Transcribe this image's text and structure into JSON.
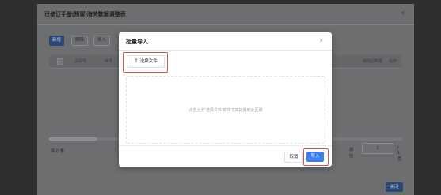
{
  "background": {
    "title": "已修订手册(预留)海关数据调整表",
    "close_symbol": "×",
    "toolbar": [
      "新增",
      "删除",
      "导入"
    ],
    "table_headers": [
      "关联号",
      "序号",
      "修改后数量",
      "操作"
    ],
    "total_text": "共 0 条",
    "pager": {
      "goto_label": "前往",
      "page_value": "1",
      "page_suffix": "/ 1 页"
    },
    "footer_button": "关闭"
  },
  "modal": {
    "title": "批量导入",
    "close_symbol": "×",
    "select_file": {
      "icon": "upload-icon",
      "label": "选择文件"
    },
    "drop_hint": "点击上方“选择文件”或将文件拖拽到此区域",
    "cancel_label": "取消",
    "import_label": "导入"
  },
  "colors": {
    "primary": "#3b7ef0",
    "highlight": "#d9534f"
  }
}
